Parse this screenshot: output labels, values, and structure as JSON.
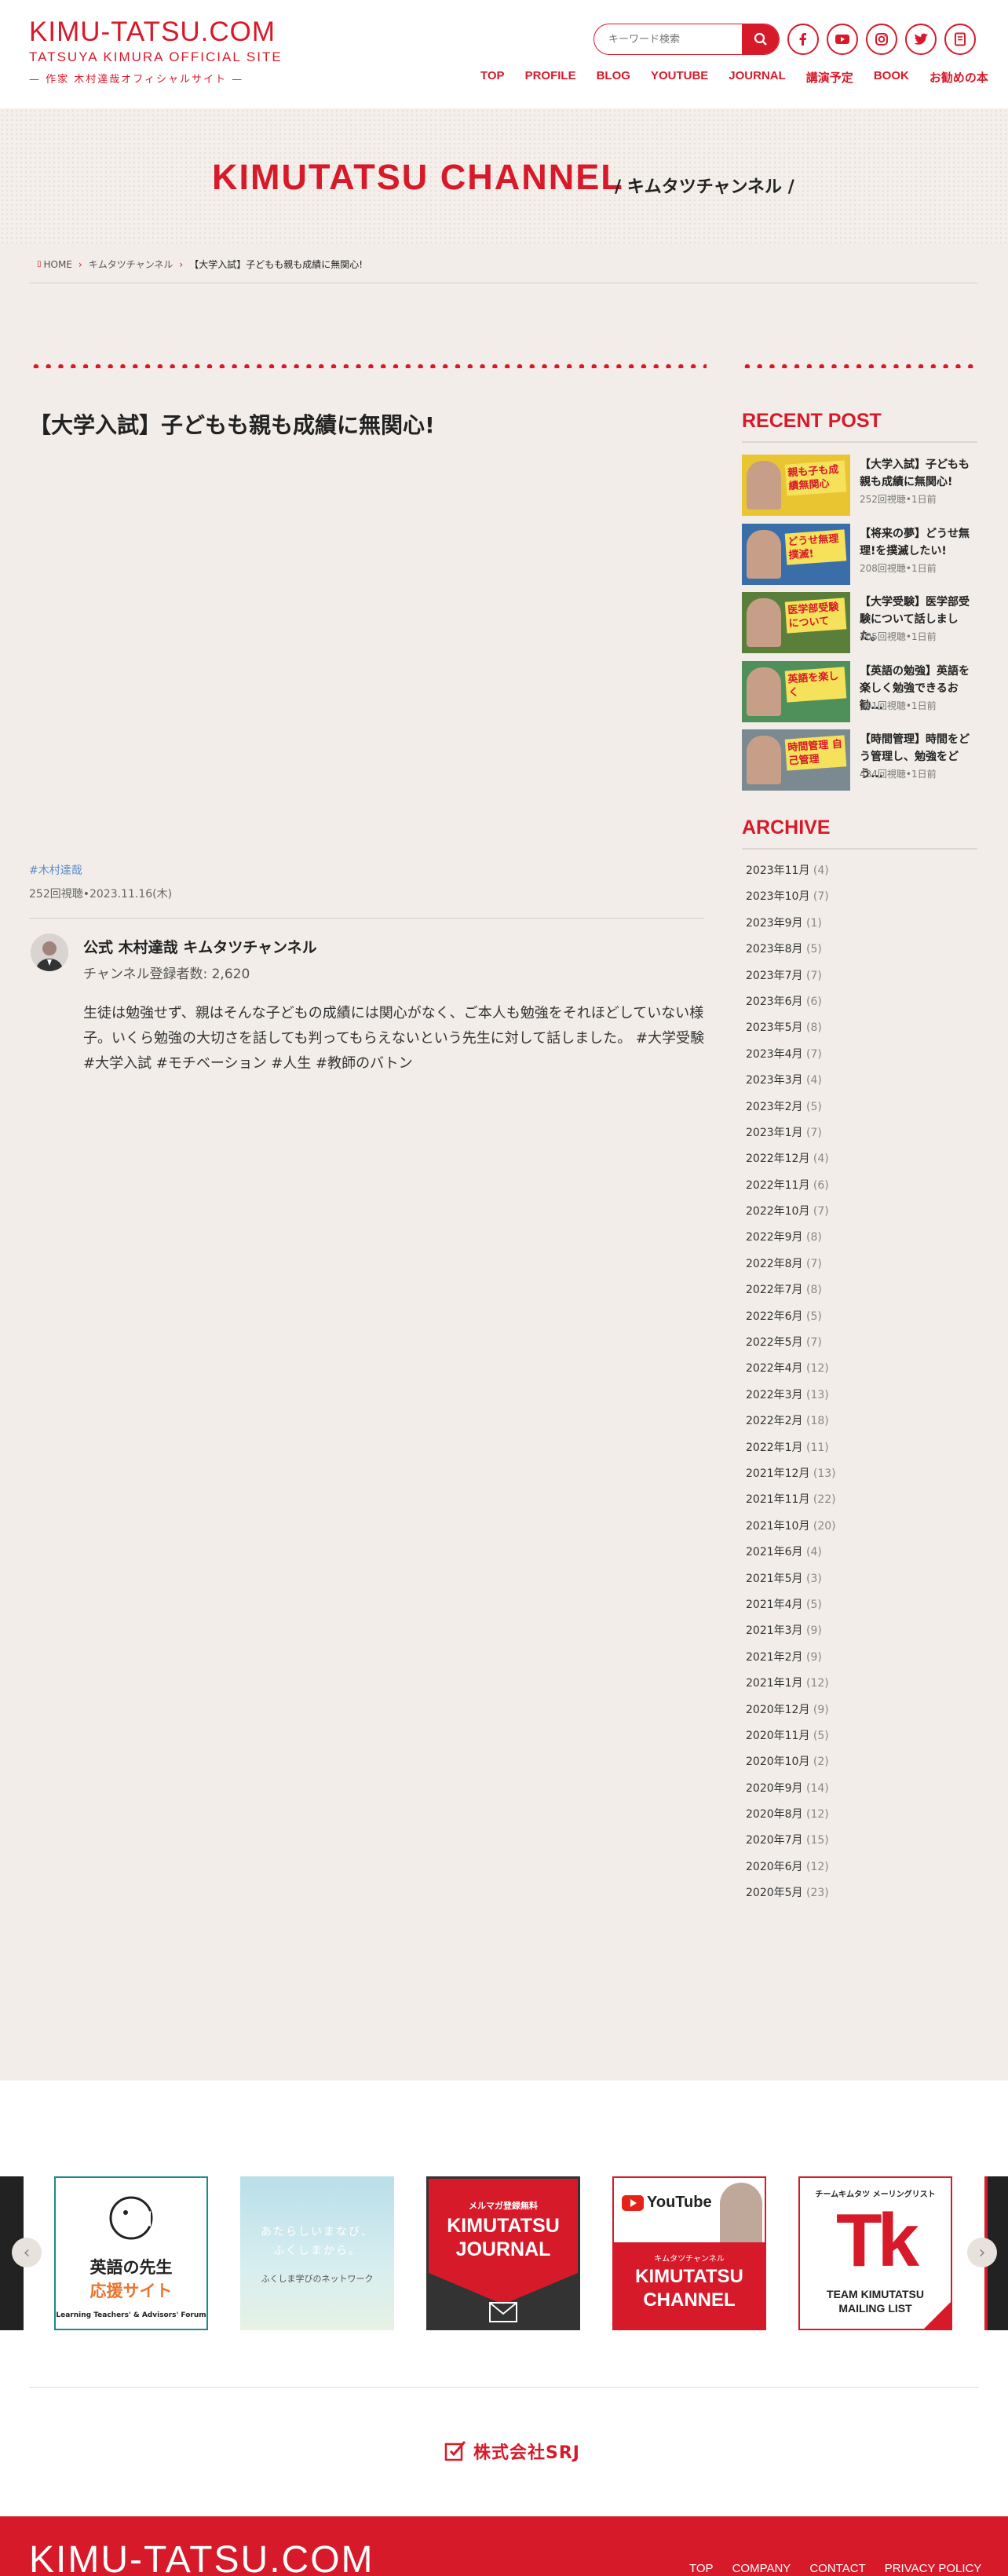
{
  "header": {
    "logo_title": "KIMU-TATSU.COM",
    "logo_sub": "TATSUYA KIMURA OFFICIAL SITE",
    "logo_tag": "— 作家 木村達哉オフィシャルサイト —",
    "search_placeholder": "キーワード検索",
    "nav": [
      "TOP",
      "PROFILE",
      "BLOG",
      "YOUTUBE",
      "JOURNAL",
      "講演予定",
      "BOOK",
      "お勧めの本"
    ],
    "sns": [
      "facebook-icon",
      "youtube-icon",
      "instagram-icon",
      "twitter-icon",
      "book-icon"
    ]
  },
  "hero": {
    "title": "KIMUTATSU CHANNEL",
    "subtitle": "/ キムタツチャンネル /"
  },
  "breadcrumb": [
    "HOME",
    "キムタツチャンネル",
    "【大学入試】子どもも親も成績に無関心!"
  ],
  "post": {
    "title": "【大学入試】子どもも親も成績に無関心!",
    "tag": "#木村達哉",
    "meta": "252回視聴•2023.11.16(木)",
    "channel_name": "公式 木村達哉 キムタツチャンネル",
    "channel_subs": "チャンネル登録者数: 2,620",
    "description": "生徒は勉強せず、親はそんな子どもの成績には関心がなく、ご本人も勉強をそれほどしていない様子。いくら勉強の大切さを話しても判ってもらえないという先生に対して話しました。 #大学受験 #大学入試 #モチベーション #人生 #教師のバトン"
  },
  "sidebar": {
    "recent_heading": "RECENT POST",
    "recent": [
      {
        "title": "【大学入試】子どもも親も成績に無関心!",
        "meta": "252回視聴•1日前",
        "thumb_text": "親も子も成績無関心",
        "thumb_bg": "#e9c531"
      },
      {
        "title": "【将来の夢】どうせ無理!を撲滅したい!",
        "meta": "208回視聴•1日前",
        "thumb_text": "どうせ無理 撲滅!",
        "thumb_bg": "#3a6ea8"
      },
      {
        "title": "【大学受験】医学部受験について話しました。",
        "meta": "405回視聴•1日前",
        "thumb_text": "医学部受験について",
        "thumb_bg": "#5a7f3a"
      },
      {
        "title": "【英語の勉強】英語を楽しく勉強できるお勧...",
        "meta": "391回視聴•1日前",
        "thumb_text": "英語を楽しく",
        "thumb_bg": "#4f8f5a"
      },
      {
        "title": "【時間管理】時間をどう管理し、勉強をどう...",
        "meta": "434回視聴•1日前",
        "thumb_text": "時間管理 自己管理",
        "thumb_bg": "#7a8a90"
      }
    ],
    "archive_heading": "ARCHIVE",
    "archive": [
      {
        "label": "2023年11月",
        "count": "(4)"
      },
      {
        "label": "2023年10月",
        "count": "(7)"
      },
      {
        "label": "2023年9月",
        "count": "(1)"
      },
      {
        "label": "2023年8月",
        "count": "(5)"
      },
      {
        "label": "2023年7月",
        "count": "(7)"
      },
      {
        "label": "2023年6月",
        "count": "(6)"
      },
      {
        "label": "2023年5月",
        "count": "(8)"
      },
      {
        "label": "2023年4月",
        "count": "(7)"
      },
      {
        "label": "2023年3月",
        "count": "(4)"
      },
      {
        "label": "2023年2月",
        "count": "(5)"
      },
      {
        "label": "2023年1月",
        "count": "(7)"
      },
      {
        "label": "2022年12月",
        "count": "(4)"
      },
      {
        "label": "2022年11月",
        "count": "(6)"
      },
      {
        "label": "2022年10月",
        "count": "(7)"
      },
      {
        "label": "2022年9月",
        "count": "(8)"
      },
      {
        "label": "2022年8月",
        "count": "(7)"
      },
      {
        "label": "2022年7月",
        "count": "(8)"
      },
      {
        "label": "2022年6月",
        "count": "(5)"
      },
      {
        "label": "2022年5月",
        "count": "(7)"
      },
      {
        "label": "2022年4月",
        "count": "(12)"
      },
      {
        "label": "2022年3月",
        "count": "(13)"
      },
      {
        "label": "2022年2月",
        "count": "(18)"
      },
      {
        "label": "2022年1月",
        "count": "(11)"
      },
      {
        "label": "2021年12月",
        "count": "(13)"
      },
      {
        "label": "2021年11月",
        "count": "(22)"
      },
      {
        "label": "2021年10月",
        "count": "(20)"
      },
      {
        "label": "2021年6月",
        "count": "(4)"
      },
      {
        "label": "2021年5月",
        "count": "(3)"
      },
      {
        "label": "2021年4月",
        "count": "(5)"
      },
      {
        "label": "2021年3月",
        "count": "(9)"
      },
      {
        "label": "2021年2月",
        "count": "(9)"
      },
      {
        "label": "2021年1月",
        "count": "(12)"
      },
      {
        "label": "2020年12月",
        "count": "(9)"
      },
      {
        "label": "2020年11月",
        "count": "(5)"
      },
      {
        "label": "2020年10月",
        "count": "(2)"
      },
      {
        "label": "2020年9月",
        "count": "(14)"
      },
      {
        "label": "2020年8月",
        "count": "(12)"
      },
      {
        "label": "2020年7月",
        "count": "(15)"
      },
      {
        "label": "2020年6月",
        "count": "(12)"
      },
      {
        "label": "2020年5月",
        "count": "(23)"
      }
    ]
  },
  "banners": {
    "teacher": {
      "line1": "英語の先生",
      "line2": "応援サイト",
      "line3": "Learning Teachers' & Advisors' Forum"
    },
    "fukushima": {
      "line1": "あたらしいまなび、",
      "line2": "ふくしまから。",
      "line3": "ふくしま学びのネットワーク"
    },
    "journal": {
      "top": "メルマガ登録無料",
      "line1": "KIMUTATSU",
      "line2": "JOURNAL"
    },
    "channel": {
      "brand": "YouTube",
      "small": "キムタツチャンネル",
      "line1": "KIMUTATSU",
      "line2": "CHANNEL"
    },
    "team": {
      "top": "チームキムタツ メーリングリスト",
      "mark": "Tk",
      "line1": "TEAM KIMUTATSU",
      "line2": "MAILING LIST"
    }
  },
  "company": {
    "name": "株式会社SRJ"
  },
  "footer": {
    "logo": "KIMU-TATSU.COM",
    "links": [
      "TOP",
      "COMPANY",
      "CONTACT",
      "PRIVACY POLICY"
    ]
  },
  "colors": {
    "brand": "#d71a2a",
    "background": "#f2ede8"
  }
}
